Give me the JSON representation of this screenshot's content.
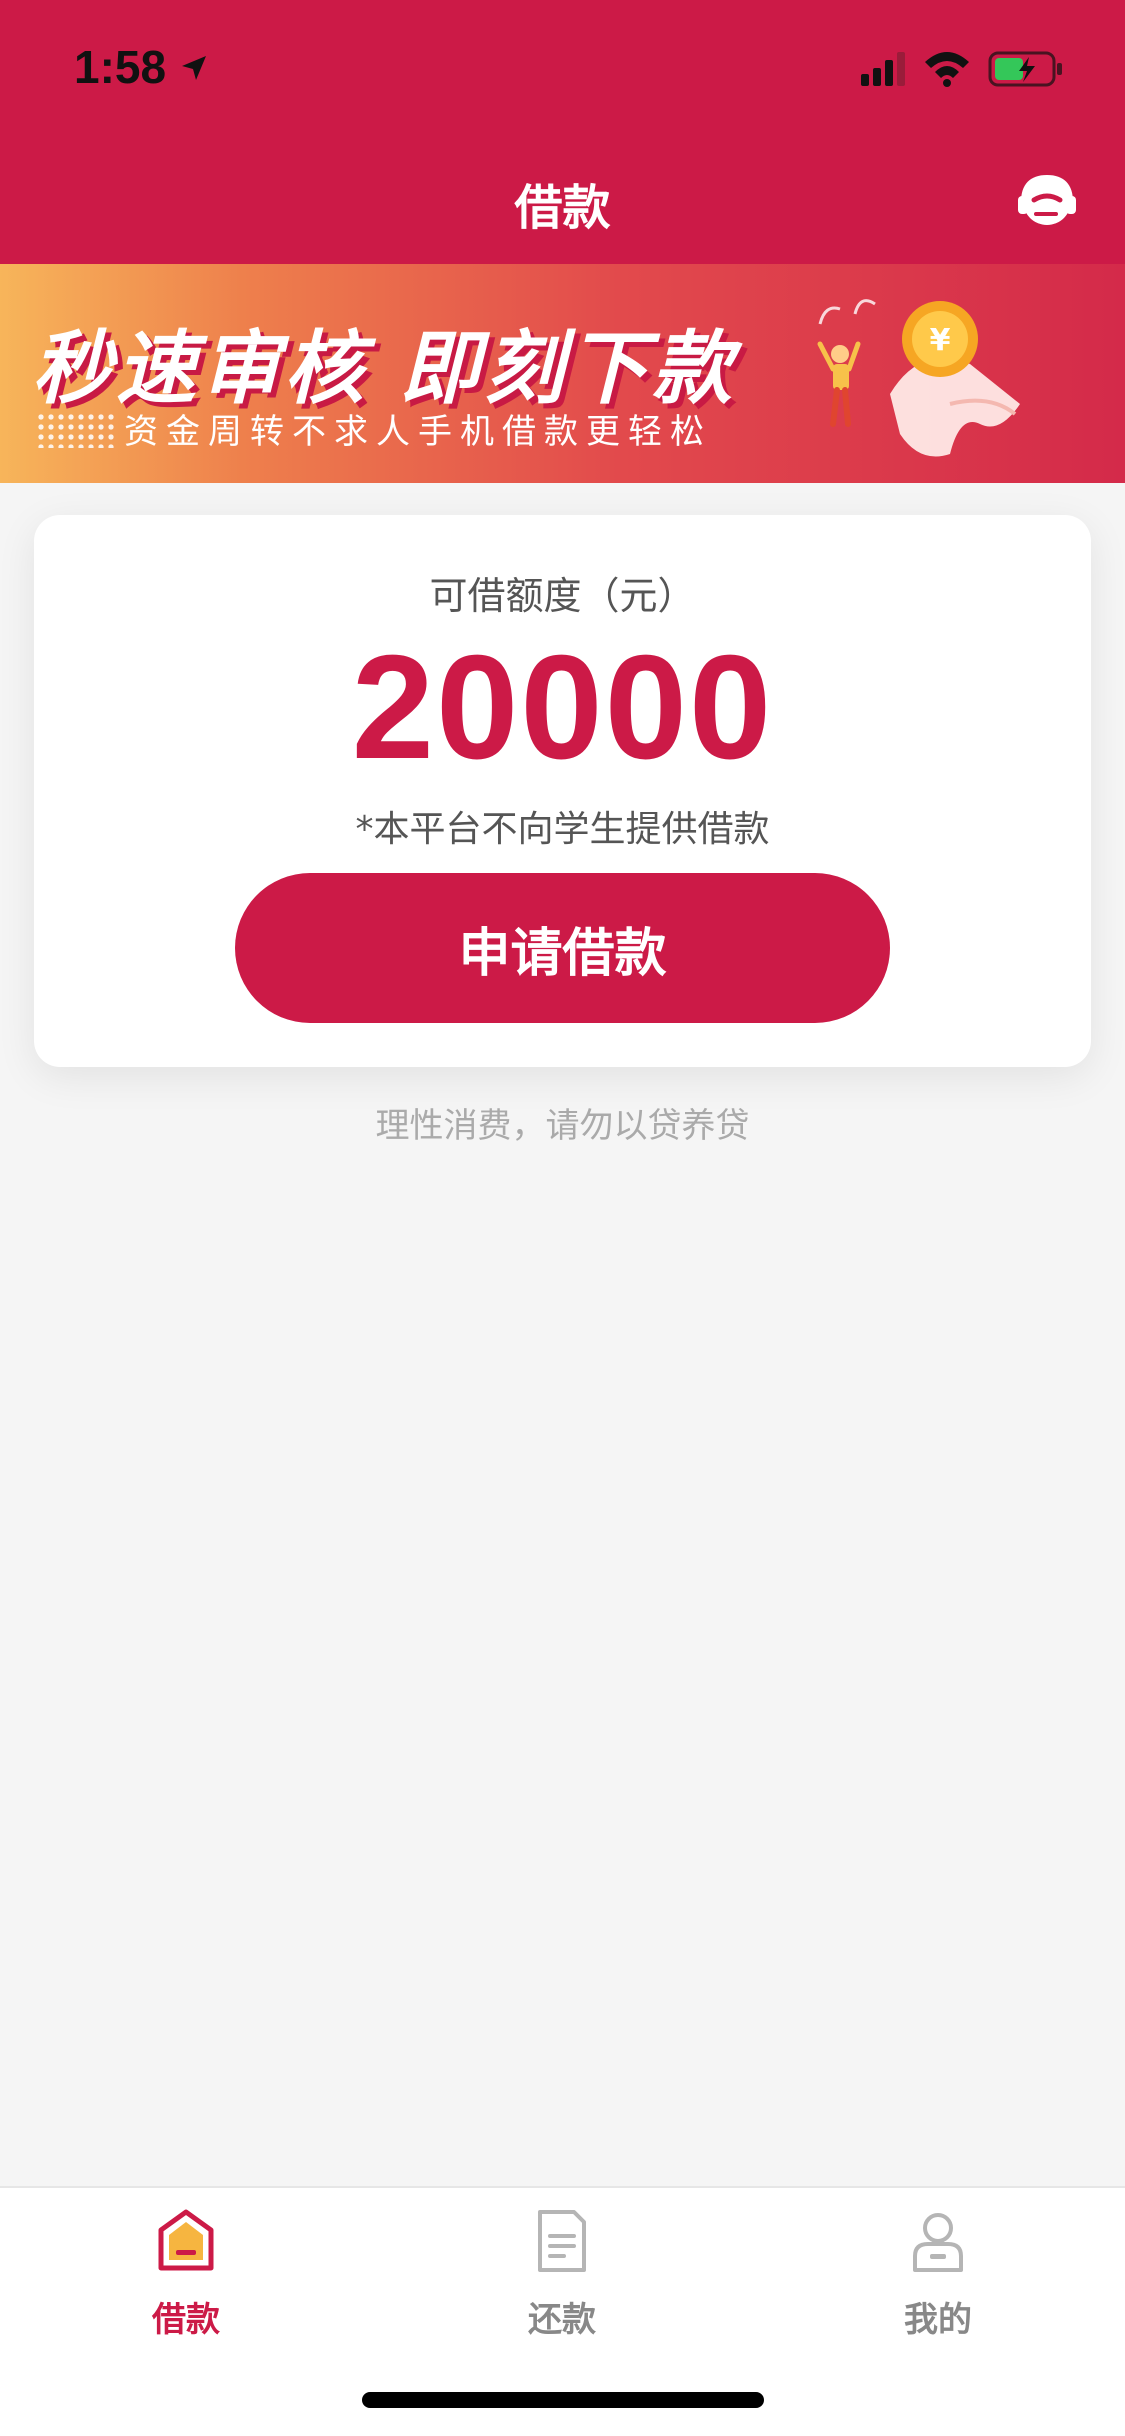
{
  "status_bar": {
    "time": "1:58"
  },
  "header": {
    "title": "借款"
  },
  "banner": {
    "headline": "秒速审核 即刻下款",
    "subline": "资金周转不求人手机借款更轻松"
  },
  "quota_card": {
    "label": "可借额度（元）",
    "amount": "20000",
    "notice": "*本平台不向学生提供借款",
    "apply_button": "申请借款"
  },
  "footer_tip": "理性消费，请勿以贷养贷",
  "tabs": [
    {
      "label": "借款",
      "icon": "home-icon",
      "active": true
    },
    {
      "label": "还款",
      "icon": "document-icon",
      "active": false
    },
    {
      "label": "我的",
      "icon": "profile-icon",
      "active": false
    }
  ],
  "colors": {
    "brand": "#cc1a47",
    "background": "#f5f5f5",
    "tab_inactive": "#888888",
    "tip_gray": "#aaaaaa"
  }
}
